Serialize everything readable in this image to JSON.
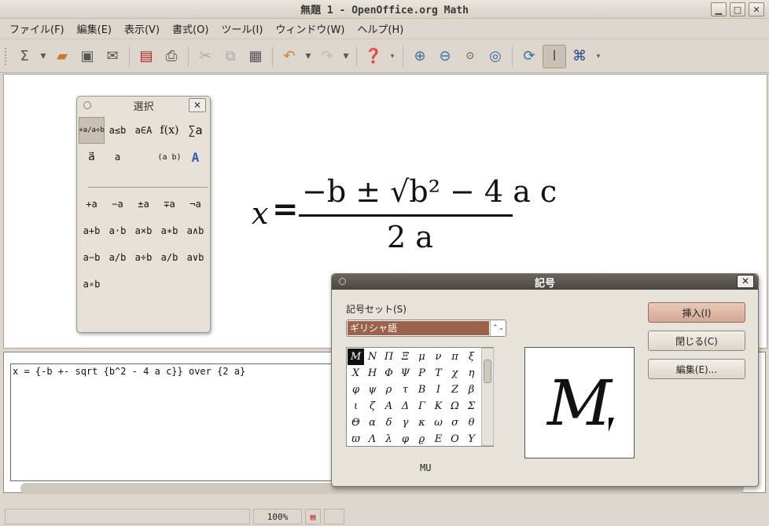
{
  "window": {
    "title": "無題 1 - OpenOffice.org Math",
    "minimize": "▁",
    "maximize": "□",
    "close": "✕"
  },
  "menu": [
    "ファイル(F)",
    "編集(E)",
    "表示(V)",
    "書式(O)",
    "ツール(I)",
    "ウィンドウ(W)",
    "ヘルプ(H)"
  ],
  "toolbar": {
    "icons": [
      "sigma-doc-icon",
      "new-arrow-icon",
      "open-folder-icon",
      "save-icon",
      "email-icon",
      "pdf-export-icon",
      "print-icon",
      "cut-icon",
      "copy-icon",
      "paste-icon",
      "undo-icon",
      "undo-arrow-icon",
      "redo-icon",
      "redo-arrow-icon",
      "help-icon",
      "more-icon",
      "zoom-in-icon",
      "zoom-out-icon",
      "zoom-100-icon",
      "show-all-icon",
      "update-icon",
      "formula-cursor-icon",
      "symbols-icon",
      "more2-icon"
    ]
  },
  "selection_window": {
    "title": "選択",
    "close": "✕",
    "categories": [
      "+a/a÷b",
      "a≤b",
      "a∈A",
      "f(x)",
      "∑a",
      "a⃗",
      "a",
      "(a b)",
      "A"
    ],
    "operators": [
      "+a",
      "−a",
      "±a",
      "∓a",
      "¬a",
      "a+b",
      "a·b",
      "a×b",
      "a∗b",
      "a∧b",
      "a−b",
      "a/b",
      "a÷b",
      "a/b",
      "a∨b",
      "a∘b"
    ]
  },
  "formula": {
    "x": "x",
    "eq": "=",
    "numerator": "−b ± √b² − 4 a c",
    "denominator": "2 a"
  },
  "command": {
    "text": "x = {-b +- sqrt {b^2 - 4 a c}} over {2 a}"
  },
  "status": {
    "zoom": "100%"
  },
  "symbols_dialog": {
    "title": "記号",
    "close": "✕",
    "set_label": "記号セット(S)",
    "set_value": "ギリシャ語",
    "symbols": [
      "M",
      "N",
      "Π",
      "Ξ",
      "μ",
      "ν",
      "π",
      "ξ",
      "Χ",
      "Η",
      "Φ",
      "Ψ",
      "Ρ",
      "Τ",
      "χ",
      "η",
      "φ",
      "ψ",
      "ρ",
      "τ",
      "Β",
      "Ι",
      "Ζ",
      "β",
      "ι",
      "ζ",
      "Α",
      "Δ",
      "Γ",
      "Κ",
      "Ω",
      "Σ",
      "Θ",
      "α",
      "δ",
      "γ",
      "κ",
      "ω",
      "σ",
      "θ",
      "ϖ",
      "Λ",
      "λ",
      "φ",
      "ϱ",
      "Ε",
      "Ο",
      "Υ"
    ],
    "preview": "M",
    "symbol_name": "MU",
    "insert": "挿入(I)",
    "close_btn": "閉じる(C)",
    "edit": "編集(E)..."
  }
}
